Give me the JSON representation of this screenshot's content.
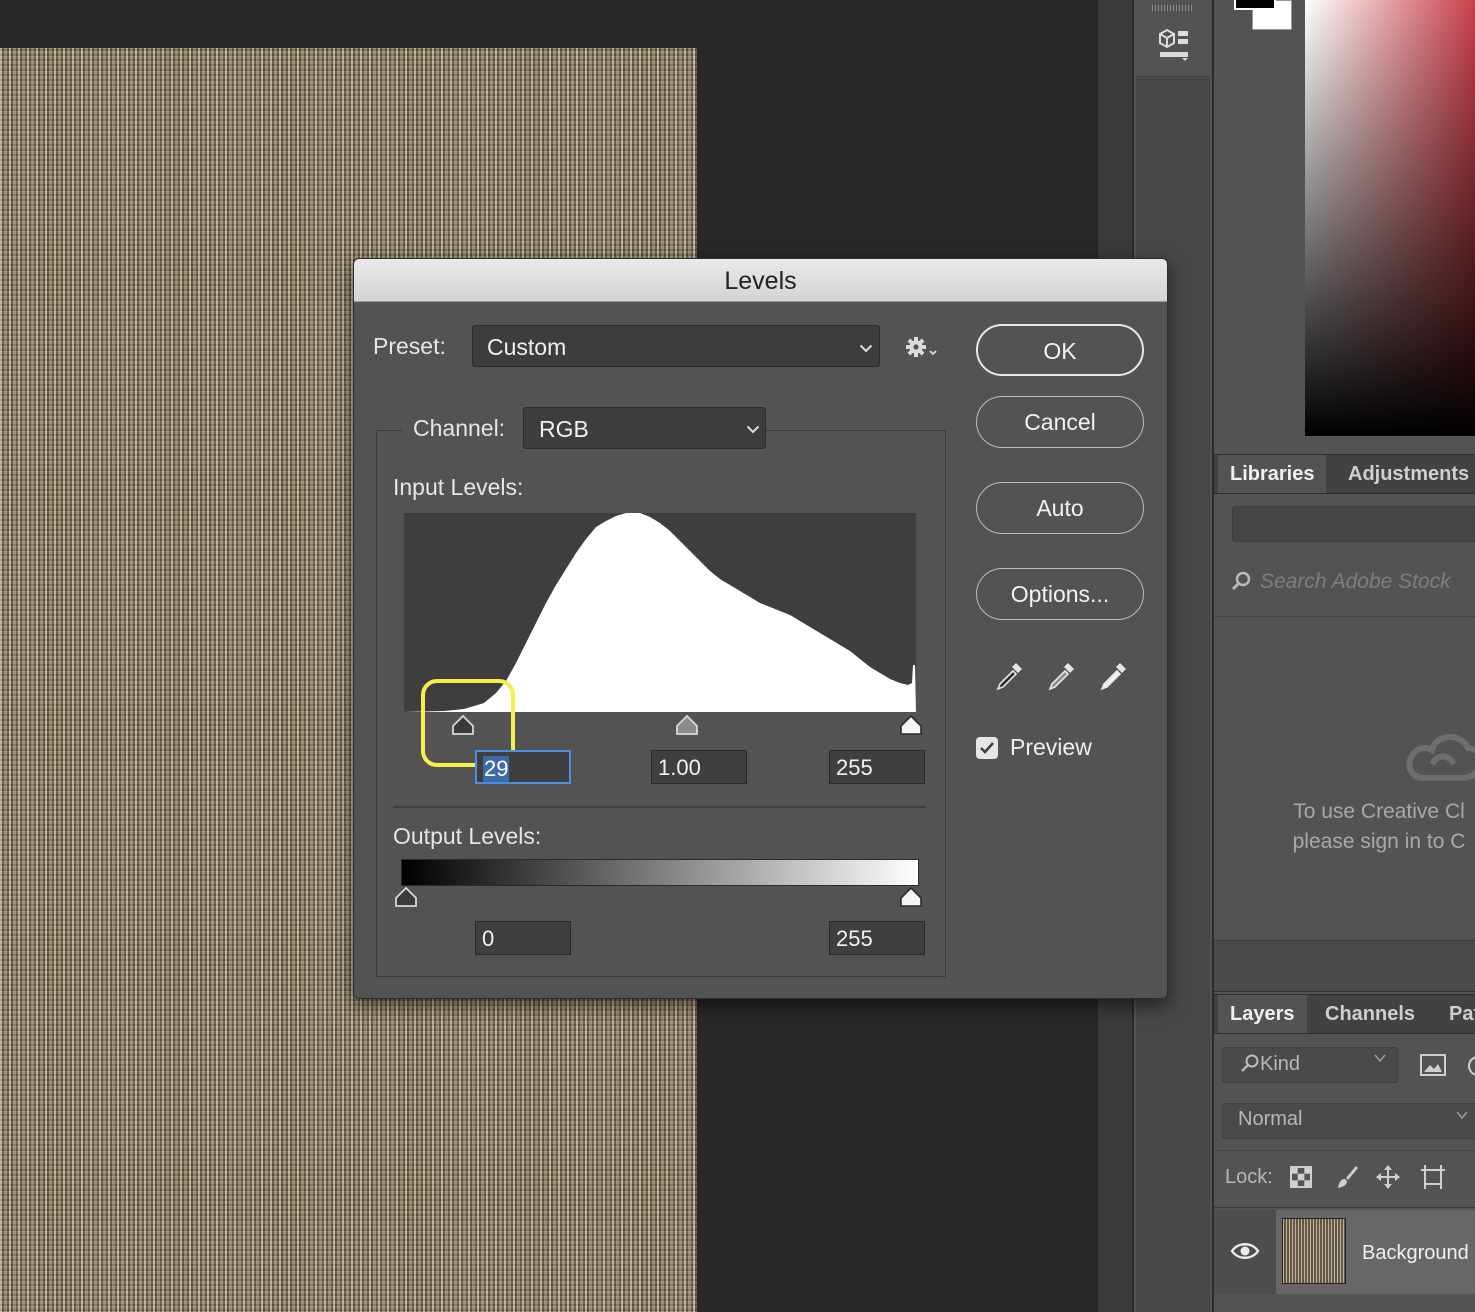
{
  "dialog": {
    "title": "Levels",
    "preset_label": "Preset:",
    "preset_value": "Custom",
    "channel_label": "Channel:",
    "channel_value": "RGB",
    "input_levels_label": "Input Levels:",
    "output_levels_label": "Output Levels:",
    "input_black": "29",
    "input_gamma": "1.00",
    "input_white": "255",
    "output_black": "0",
    "output_white": "255",
    "buttons": {
      "ok": "OK",
      "cancel": "Cancel",
      "auto": "Auto",
      "options": "Options..."
    },
    "preview_label": "Preview",
    "preview_checked": true,
    "highlight_color": "#f3f04e"
  },
  "libraries_panel": {
    "tabs": [
      "Libraries",
      "Adjustments"
    ],
    "search_placeholder": "Search Adobe Stock",
    "message_line1": "To use Creative Cl",
    "message_line2": "please sign in to C"
  },
  "layers_panel": {
    "tabs": [
      "Layers",
      "Channels",
      "Pat"
    ],
    "filter_label": "Kind",
    "blend_mode": "Normal",
    "lock_label": "Lock:",
    "layer_name": "Background"
  },
  "icons": [
    "3d-panel-icon",
    "gear-icon",
    "search-icon",
    "creative-cloud-icon",
    "eye-icon",
    "eyedropper-icon",
    "image-filter-icon",
    "lock-transparent-icon",
    "lock-paint-icon",
    "lock-move-icon",
    "lock-artboard-icon"
  ]
}
